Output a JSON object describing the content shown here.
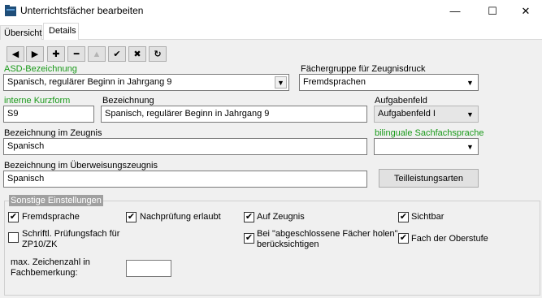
{
  "window": {
    "title": "Unterrichtsfächer bearbeiten",
    "minimize": "—",
    "maximize": "☐",
    "close": "✕"
  },
  "tabs": [
    {
      "label": "Übersicht"
    },
    {
      "label": "Details"
    }
  ],
  "toolbar": {
    "first": "◀",
    "last": "▶",
    "add": "✚",
    "remove": "━",
    "up": "▲",
    "confirm": "✔",
    "cancel": "✖",
    "refresh": "↻"
  },
  "form": {
    "asd_label": "ASD-Bezeichnung",
    "asd_value": "Spanisch, regulärer Beginn in Jahrgang 9",
    "fachgruppe_label": "Fächergruppe für Zeugnisdruck",
    "fachgruppe_value": "Fremdsprachen",
    "kurzform_label": "interne Kurzform",
    "kurzform_value": "S9",
    "bezeichnung_label": "Bezeichnung",
    "bezeichnung_value": "Spanisch, regulärer Beginn in Jahrgang 9",
    "aufgabenfeld_label": "Aufgabenfeld",
    "aufgabenfeld_value": "Aufgabenfeld I",
    "zeugnis_label": "Bezeichnung im Zeugnis",
    "zeugnis_value": "Spanisch",
    "bilingual_label": "bilinguale Sachfachsprache",
    "bilingual_value": "",
    "ueberweisung_label": "Bezeichnung im Überweisungszeugnis",
    "ueberweisung_value": "Spanisch",
    "teilleistung_button": "Teilleistungsarten"
  },
  "settings": {
    "title": "Sonstige Einstellungen",
    "fremdsprache": {
      "label": "Fremdsprache",
      "checked": true
    },
    "nachpruefung": {
      "label": "Nachprüfung erlaubt",
      "checked": true
    },
    "auf_zeugnis": {
      "label": "Auf Zeugnis",
      "checked": true
    },
    "sichtbar": {
      "label": "Sichtbar",
      "checked": true
    },
    "schriftl_line1": "Schriftl. Prüfungsfach für",
    "schriftl_line2": "ZP10/ZK",
    "schriftl_checked": false,
    "abgeschlossen_line1": "Bei \"abgeschlossene Fächer holen\"",
    "abgeschlossen_line2": "berücksichtigen",
    "abgeschlossen_checked": true,
    "oberstufe": {
      "label": "Fach der Oberstufe",
      "checked": true
    },
    "max_label_line1": "max. Zeichenzahl in",
    "max_label_line2": "Fachbemerkung:",
    "max_value": "",
    "check_glyph": "✔"
  },
  "icons": {
    "dropdown": "▼"
  }
}
